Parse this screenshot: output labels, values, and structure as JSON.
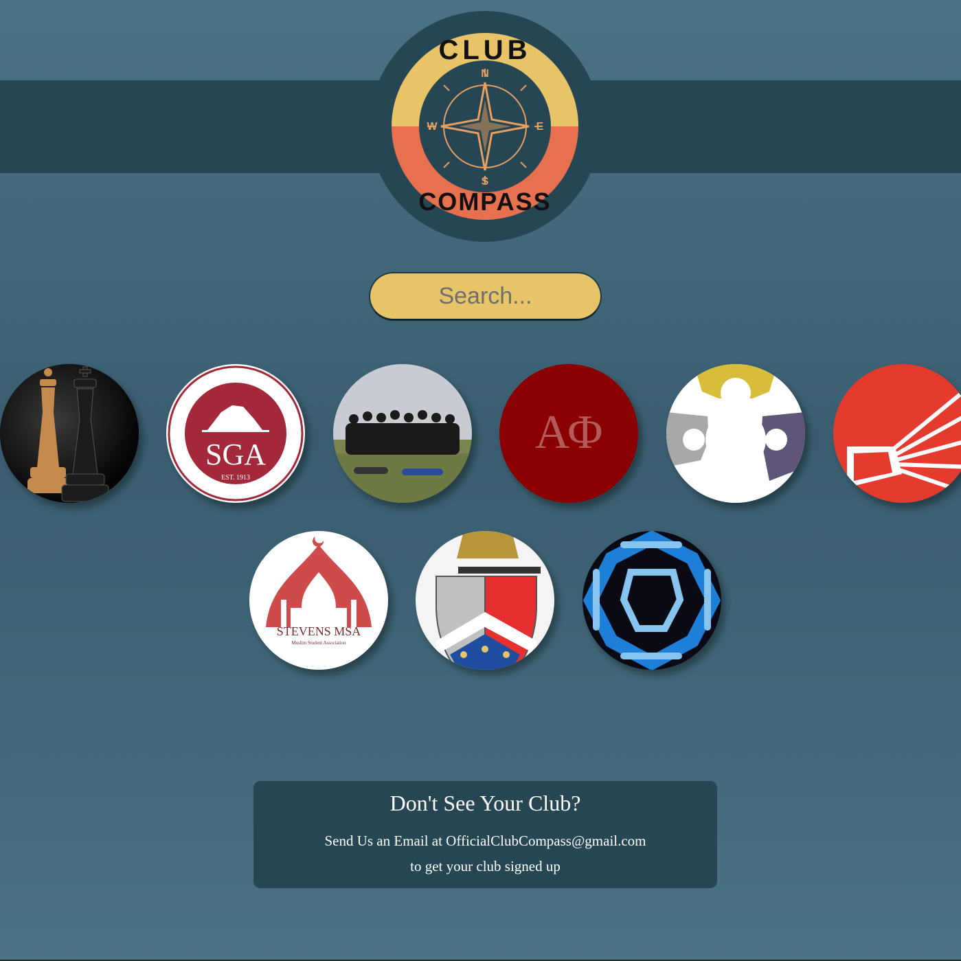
{
  "logo": {
    "top_text": "CLUB",
    "bottom_text": "COMPASS",
    "compass_points": [
      "N",
      "E",
      "S",
      "W"
    ],
    "colors": {
      "ring": "#264654",
      "top": "#e8c468",
      "bottom": "#e7704f",
      "star": "#e8a060"
    }
  },
  "search": {
    "placeholder": "Search..."
  },
  "clubs": [
    {
      "icon": "chess-pieces-logo"
    },
    {
      "icon": "sga-seal-logo",
      "text_main": "SGA",
      "text_est": "EST. 1913"
    },
    {
      "icon": "team-photo"
    },
    {
      "icon": "alpha-phi-logo",
      "text": "ΑΦ"
    },
    {
      "icon": "gear-puzzle-logo"
    },
    {
      "icon": "megaphone-logo"
    },
    {
      "icon": "msa-mosque-logo",
      "text_main": "STEVENS MSA",
      "text_sub": "Muslim Student Association"
    },
    {
      "icon": "crest-shield-logo"
    },
    {
      "icon": "celtic-knot-logo"
    }
  ],
  "footer": {
    "heading": "Don't See Your Club?",
    "line1": "Send Us an Email at OfficialClubCompass@gmail.com",
    "line2": "to get your club signed up"
  }
}
